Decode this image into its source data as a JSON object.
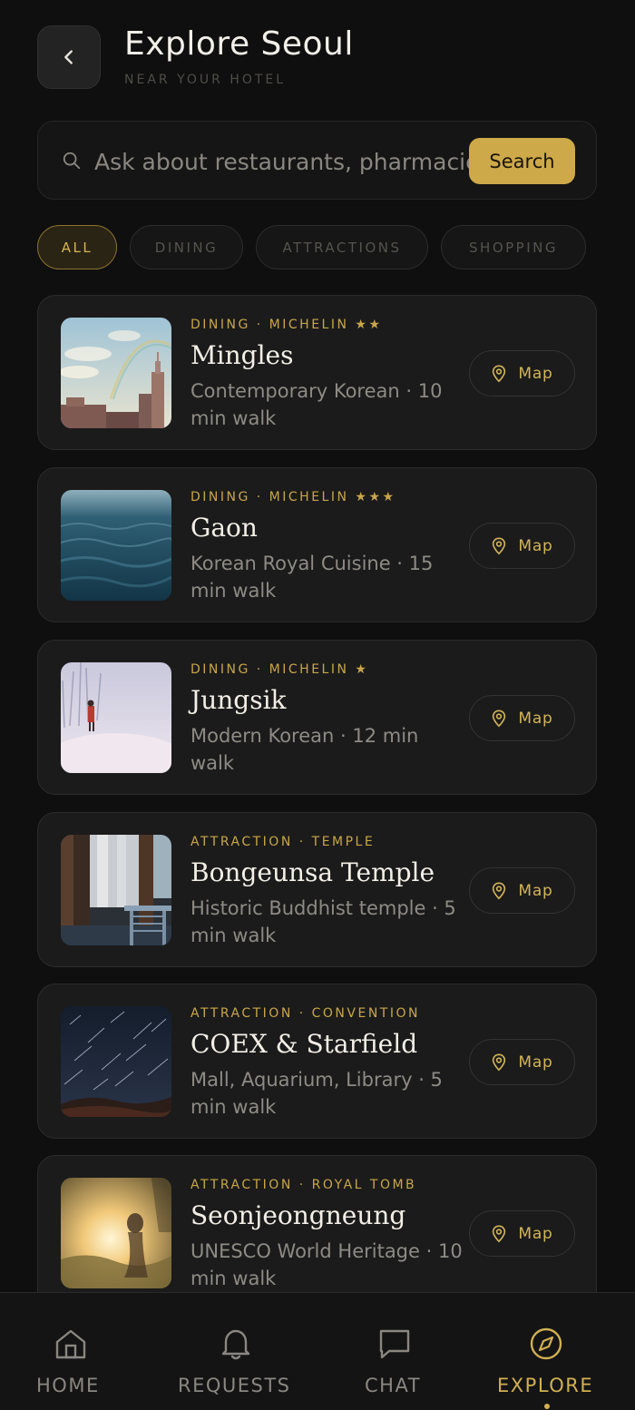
{
  "header": {
    "title": "Explore Seoul",
    "subtitle": "NEAR YOUR HOTEL"
  },
  "search": {
    "placeholder": "Ask about restaurants, pharmacies, attractions...",
    "button_label": "Search"
  },
  "filters": [
    {
      "label": "ALL",
      "active": true
    },
    {
      "label": "DINING",
      "active": false
    },
    {
      "label": "ATTRACTIONS",
      "active": false
    },
    {
      "label": "SHOPPING",
      "active": false
    }
  ],
  "places": [
    {
      "meta": "DINING · MICHELIN ★★",
      "name": "Mingles",
      "description": "Contemporary Korean · 10 min walk",
      "map_label": "Map"
    },
    {
      "meta": "DINING · MICHELIN ★★★",
      "name": "Gaon",
      "description": "Korean Royal Cuisine · 15 min walk",
      "map_label": "Map"
    },
    {
      "meta": "DINING · MICHELIN ★",
      "name": "Jungsik",
      "description": "Modern Korean · 12 min walk",
      "map_label": "Map"
    },
    {
      "meta": "ATTRACTION · TEMPLE",
      "name": "Bongeunsa Temple",
      "description": "Historic Buddhist temple · 5 min walk",
      "map_label": "Map"
    },
    {
      "meta": "ATTRACTION · CONVENTION",
      "name": "COEX & Starfield",
      "description": "Mall, Aquarium, Library · 5 min walk",
      "map_label": "Map"
    },
    {
      "meta": "ATTRACTION · ROYAL TOMB",
      "name": "Seonjeongneung",
      "description": "UNESCO World Heritage · 10 min walk",
      "map_label": "Map"
    }
  ],
  "nav": [
    {
      "label": "HOME",
      "icon": "home-icon",
      "active": false
    },
    {
      "label": "REQUESTS",
      "icon": "bell-icon",
      "active": false
    },
    {
      "label": "CHAT",
      "icon": "chat-icon",
      "active": false
    },
    {
      "label": "EXPLORE",
      "icon": "compass-icon",
      "active": true
    }
  ],
  "colors": {
    "background": "#0f0f0f",
    "card": "#1b1b1b",
    "accent": "#cda94a"
  }
}
